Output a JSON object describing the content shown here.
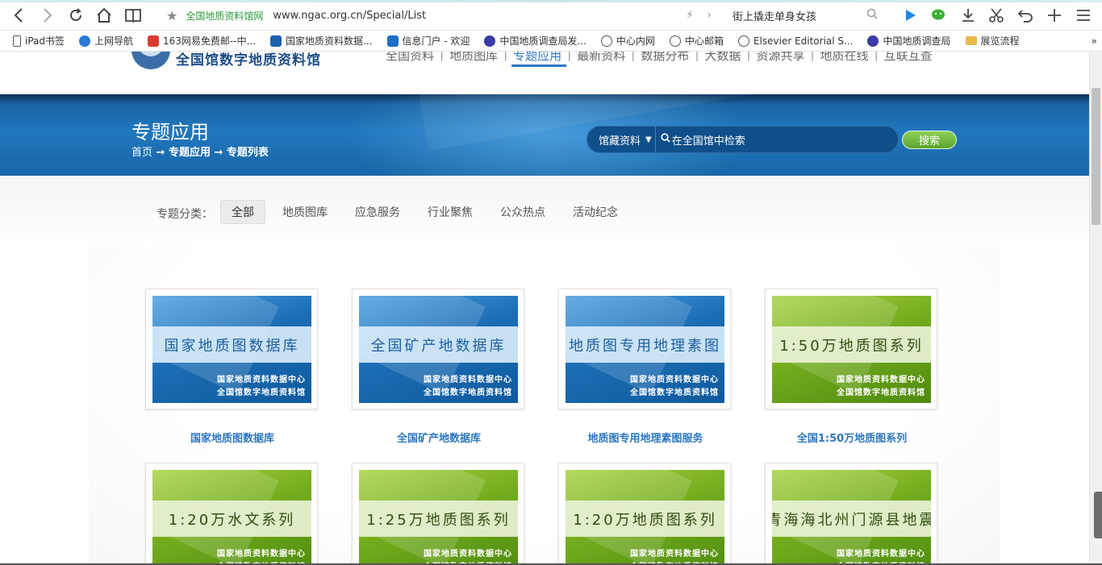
{
  "browser": {
    "site_name": "全国地质资料馆网",
    "url": "www.ngac.org.cn/Special/List",
    "search_text": "街上撬走单身女孩"
  },
  "bookmarks": [
    {
      "label": "iPad书签",
      "icon": "tablet-icon",
      "color": "#555555"
    },
    {
      "label": "上网导航",
      "icon": "ie-icon",
      "color": "#2a7ad6"
    },
    {
      "label": "163网易免费邮--中...",
      "icon": "netease-icon",
      "color": "#d83a2f"
    },
    {
      "label": "国家地质资料数据...",
      "icon": "database-icon",
      "color": "#1f5fb0"
    },
    {
      "label": "信息门户 - 欢迎",
      "icon": "sharepoint-icon",
      "color": "#1f6fc4"
    },
    {
      "label": "中国地质调查局发...",
      "icon": "cgs-icon",
      "color": "#3a3aa8"
    },
    {
      "label": "中心内网",
      "icon": "globe-icon",
      "color": "#555555"
    },
    {
      "label": "中心邮箱",
      "icon": "globe-icon",
      "color": "#555555"
    },
    {
      "label": "Elsevier Editorial S...",
      "icon": "globe-icon",
      "color": "#555555"
    },
    {
      "label": "中国地质调查局",
      "icon": "cgs-icon",
      "color": "#3a3aa8"
    },
    {
      "label": "展览流程",
      "icon": "folder-icon",
      "color": "#e8b84a"
    }
  ],
  "site": {
    "logo_text": "全国馆数字地质资料馆",
    "nav": [
      "全国资料",
      "地质图库",
      "专题应用",
      "最新资料",
      "数据分布",
      "大数据",
      "资源共享",
      "地质在线",
      "互联互查"
    ],
    "nav_active": "专题应用"
  },
  "banner": {
    "title": "专题应用",
    "breadcrumb_home": "首页",
    "breadcrumb_rest": "→ 专题应用 → 专题列表",
    "search_scope": "馆藏资料",
    "search_placeholder": "在全国馆中检索",
    "search_button": "搜索"
  },
  "filter": {
    "label": "专题分类：",
    "options": [
      "全部",
      "地质图库",
      "应急服务",
      "行业聚焦",
      "公众热点",
      "活动纪念"
    ],
    "active": "全部"
  },
  "cards": [
    {
      "band": "国家地质图数据库",
      "caption": "国家地质图数据库",
      "theme": "blue"
    },
    {
      "band": "全国矿产地数据库",
      "caption": "全国矿产地数据库",
      "theme": "blue"
    },
    {
      "band": "地质图专用地理素图",
      "caption": "地质图专用地理素图服务",
      "theme": "blue"
    },
    {
      "band": "1:50万地质图系列",
      "caption": "全国1:50万地质图系列",
      "theme": "green"
    },
    {
      "band": "1:20万水文系列",
      "caption": "",
      "theme": "green"
    },
    {
      "band": "1:25万地质图系列",
      "caption": "",
      "theme": "green"
    },
    {
      "band": "1:20万地质图系列",
      "caption": "",
      "theme": "green"
    },
    {
      "band": "青海海北州门源县地震",
      "caption": "",
      "theme": "green"
    }
  ],
  "card_org_line1": "国家地质资料数据中心",
  "card_org_line2": "全国馆数字地质资料馆"
}
